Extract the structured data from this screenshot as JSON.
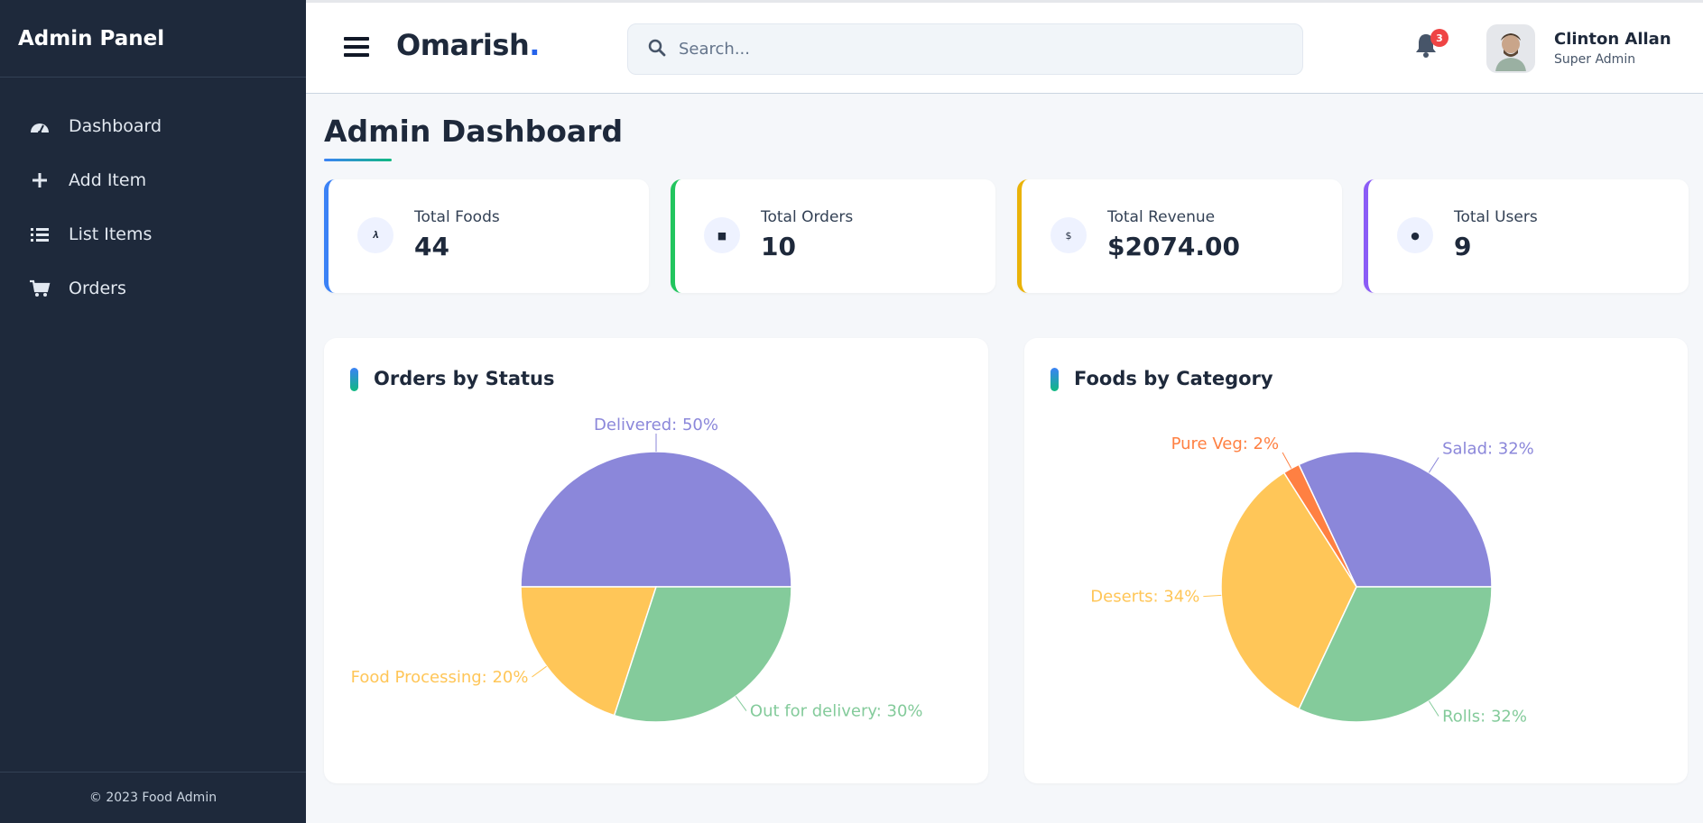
{
  "sidebar": {
    "title": "Admin Panel",
    "items": [
      {
        "label": "Dashboard",
        "icon": "dashboard-gauge-icon"
      },
      {
        "label": "Add Item",
        "icon": "plus-icon"
      },
      {
        "label": "List Items",
        "icon": "list-icon"
      },
      {
        "label": "Orders",
        "icon": "cart-icon"
      }
    ],
    "footer": "© 2023 Food Admin"
  },
  "header": {
    "brand": "Omarish",
    "brand_dot": ".",
    "search_placeholder": "Search...",
    "notification_count": "3",
    "user": {
      "name": "Clinton Allan",
      "role": "Super Admin"
    }
  },
  "page": {
    "title": "Admin Dashboard"
  },
  "stats": [
    {
      "label": "Total Foods",
      "value": "44",
      "accent": "#3b82f6",
      "icon": "utensils-icon"
    },
    {
      "label": "Total Orders",
      "value": "10",
      "accent": "#22c55e",
      "icon": "cart-icon"
    },
    {
      "label": "Total Revenue",
      "value": "$2074.00",
      "accent": "#eab308",
      "icon": "dollar-icon"
    },
    {
      "label": "Total Users",
      "value": "9",
      "accent": "#8b5cf6",
      "icon": "users-icon"
    }
  ],
  "charts_titles": {
    "orders": "Orders by Status",
    "foods": "Foods by Category"
  },
  "chart_data": [
    {
      "type": "pie",
      "title": "Orders by Status",
      "slices": [
        {
          "label": "Delivered",
          "value": 50,
          "color": "#8b87da"
        },
        {
          "label": "Food Processing",
          "value": 20,
          "color": "#ffc658"
        },
        {
          "label": "Out for delivery",
          "value": 30,
          "color": "#84cb9b"
        }
      ]
    },
    {
      "type": "pie",
      "title": "Foods by Category",
      "slices": [
        {
          "label": "Salad",
          "value": 32,
          "color": "#8b87da"
        },
        {
          "label": "Pure Veg",
          "value": 2,
          "color": "#ff8042"
        },
        {
          "label": "Deserts",
          "value": 34,
          "color": "#ffc658"
        },
        {
          "label": "Rolls",
          "value": 32,
          "color": "#84cb9b"
        }
      ]
    }
  ]
}
